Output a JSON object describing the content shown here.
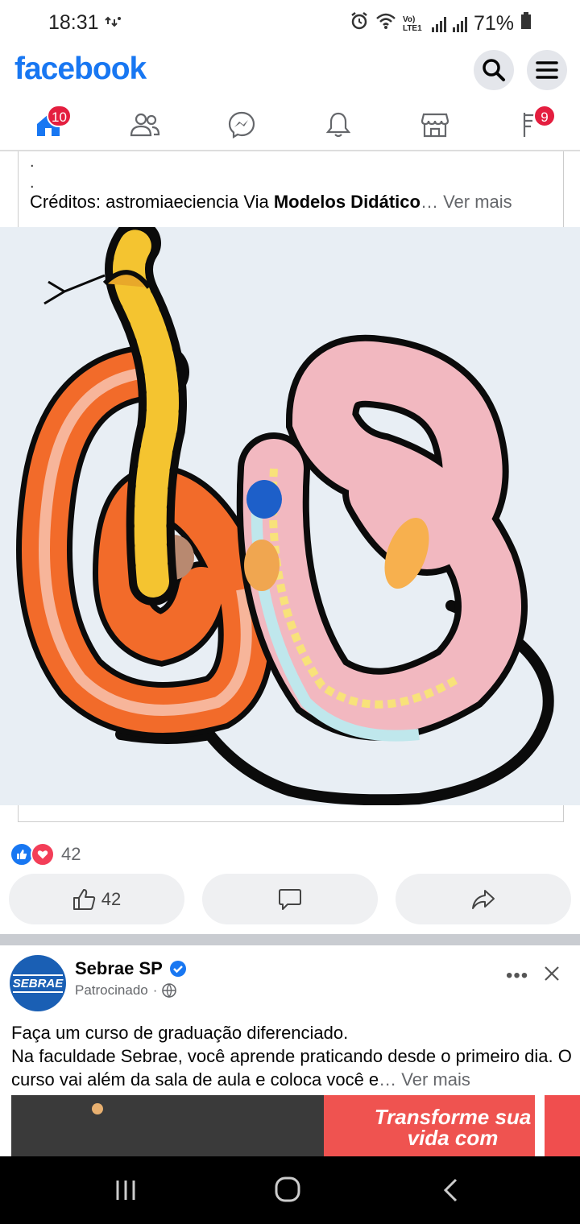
{
  "status_bar": {
    "time": "18:31",
    "network": "Vo) LTE1",
    "battery": "71%"
  },
  "header": {
    "logo": "facebook"
  },
  "nav": {
    "home_badge": "10",
    "marketplace_badge": "9"
  },
  "post": {
    "caption_prefix": "Créditos: astromiaeciencia Via ",
    "caption_bold": "Modelos Didático",
    "see_more": "Ver mais",
    "reaction_count": "42",
    "like_count": "42"
  },
  "ad": {
    "name": "Sebrae SP",
    "sponsored": "Patrocinado",
    "avatar_text": "SEBRAE",
    "text_line1": "Faça um curso de graduação diferenciado.",
    "text_line2": "Na faculdade Sebrae, você aprende praticando desde o primeiro dia. O curso vai além da sala de aula e coloca você e",
    "see_more": "Ver mais",
    "image_text": "Transforme sua vida com"
  }
}
